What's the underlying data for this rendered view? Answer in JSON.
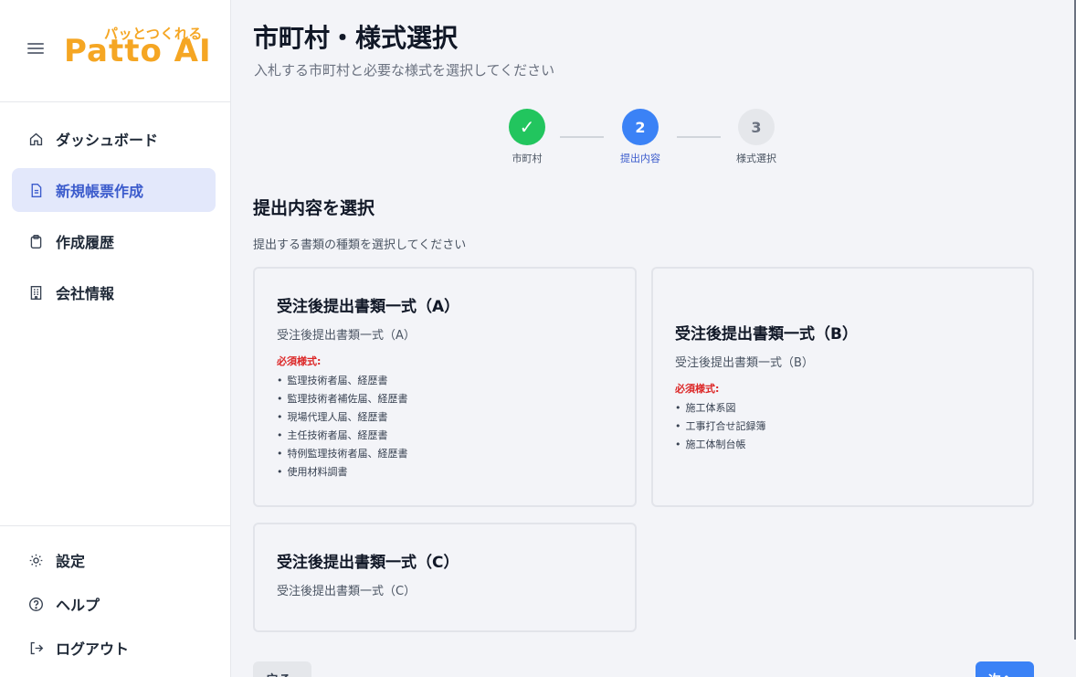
{
  "brand": {
    "tagline": "パッとつくれる",
    "name": "Patto AI"
  },
  "sidebar": {
    "items": [
      {
        "label": "ダッシュボード",
        "icon": "home-icon"
      },
      {
        "label": "新規帳票作成",
        "icon": "document-icon",
        "active": true
      },
      {
        "label": "作成履歴",
        "icon": "clipboard-icon"
      },
      {
        "label": "会社情報",
        "icon": "building-icon"
      }
    ],
    "bottom": [
      {
        "label": "設定",
        "icon": "gear-icon"
      },
      {
        "label": "ヘルプ",
        "icon": "help-icon"
      },
      {
        "label": "ログアウト",
        "icon": "logout-icon"
      }
    ]
  },
  "header": {
    "title": "市町村・様式選択",
    "subtitle": "入札する市町村と必要な様式を選択してください"
  },
  "stepper": {
    "steps": [
      {
        "symbol": "✓",
        "label": "市町村",
        "state": "done"
      },
      {
        "symbol": "2",
        "label": "提出内容",
        "state": "current"
      },
      {
        "symbol": "3",
        "label": "様式選択",
        "state": "todo"
      }
    ]
  },
  "section": {
    "title": "提出内容を選択",
    "subtitle": "提出する書類の種類を選択してください"
  },
  "cards": [
    {
      "title": "受注後提出書類一式（A）",
      "subtitle": "受注後提出書類一式（A）",
      "required_label": "必須様式:",
      "items": [
        "監理技術者届、経歴書",
        "監理技術者補佐届、経歴書",
        "現場代理人届、経歴書",
        "主任技術者届、経歴書",
        "特例監理技術者届、経歴書",
        "使用材料調書"
      ]
    },
    {
      "title": "受注後提出書類一式（B）",
      "subtitle": "受注後提出書類一式（B）",
      "required_label": "必須様式:",
      "items": [
        "施工体系図",
        "工事打合せ記録簿",
        "施工体制台帳"
      ]
    },
    {
      "title": "受注後提出書類一式（C）",
      "subtitle": "受注後提出書類一式（C）"
    }
  ],
  "actions": {
    "back_label": "戻る",
    "next_label": "次へ"
  },
  "colors": {
    "brand": "#f5a623",
    "primary": "#3b82f6",
    "success": "#22c55e",
    "required": "#dc2626"
  }
}
